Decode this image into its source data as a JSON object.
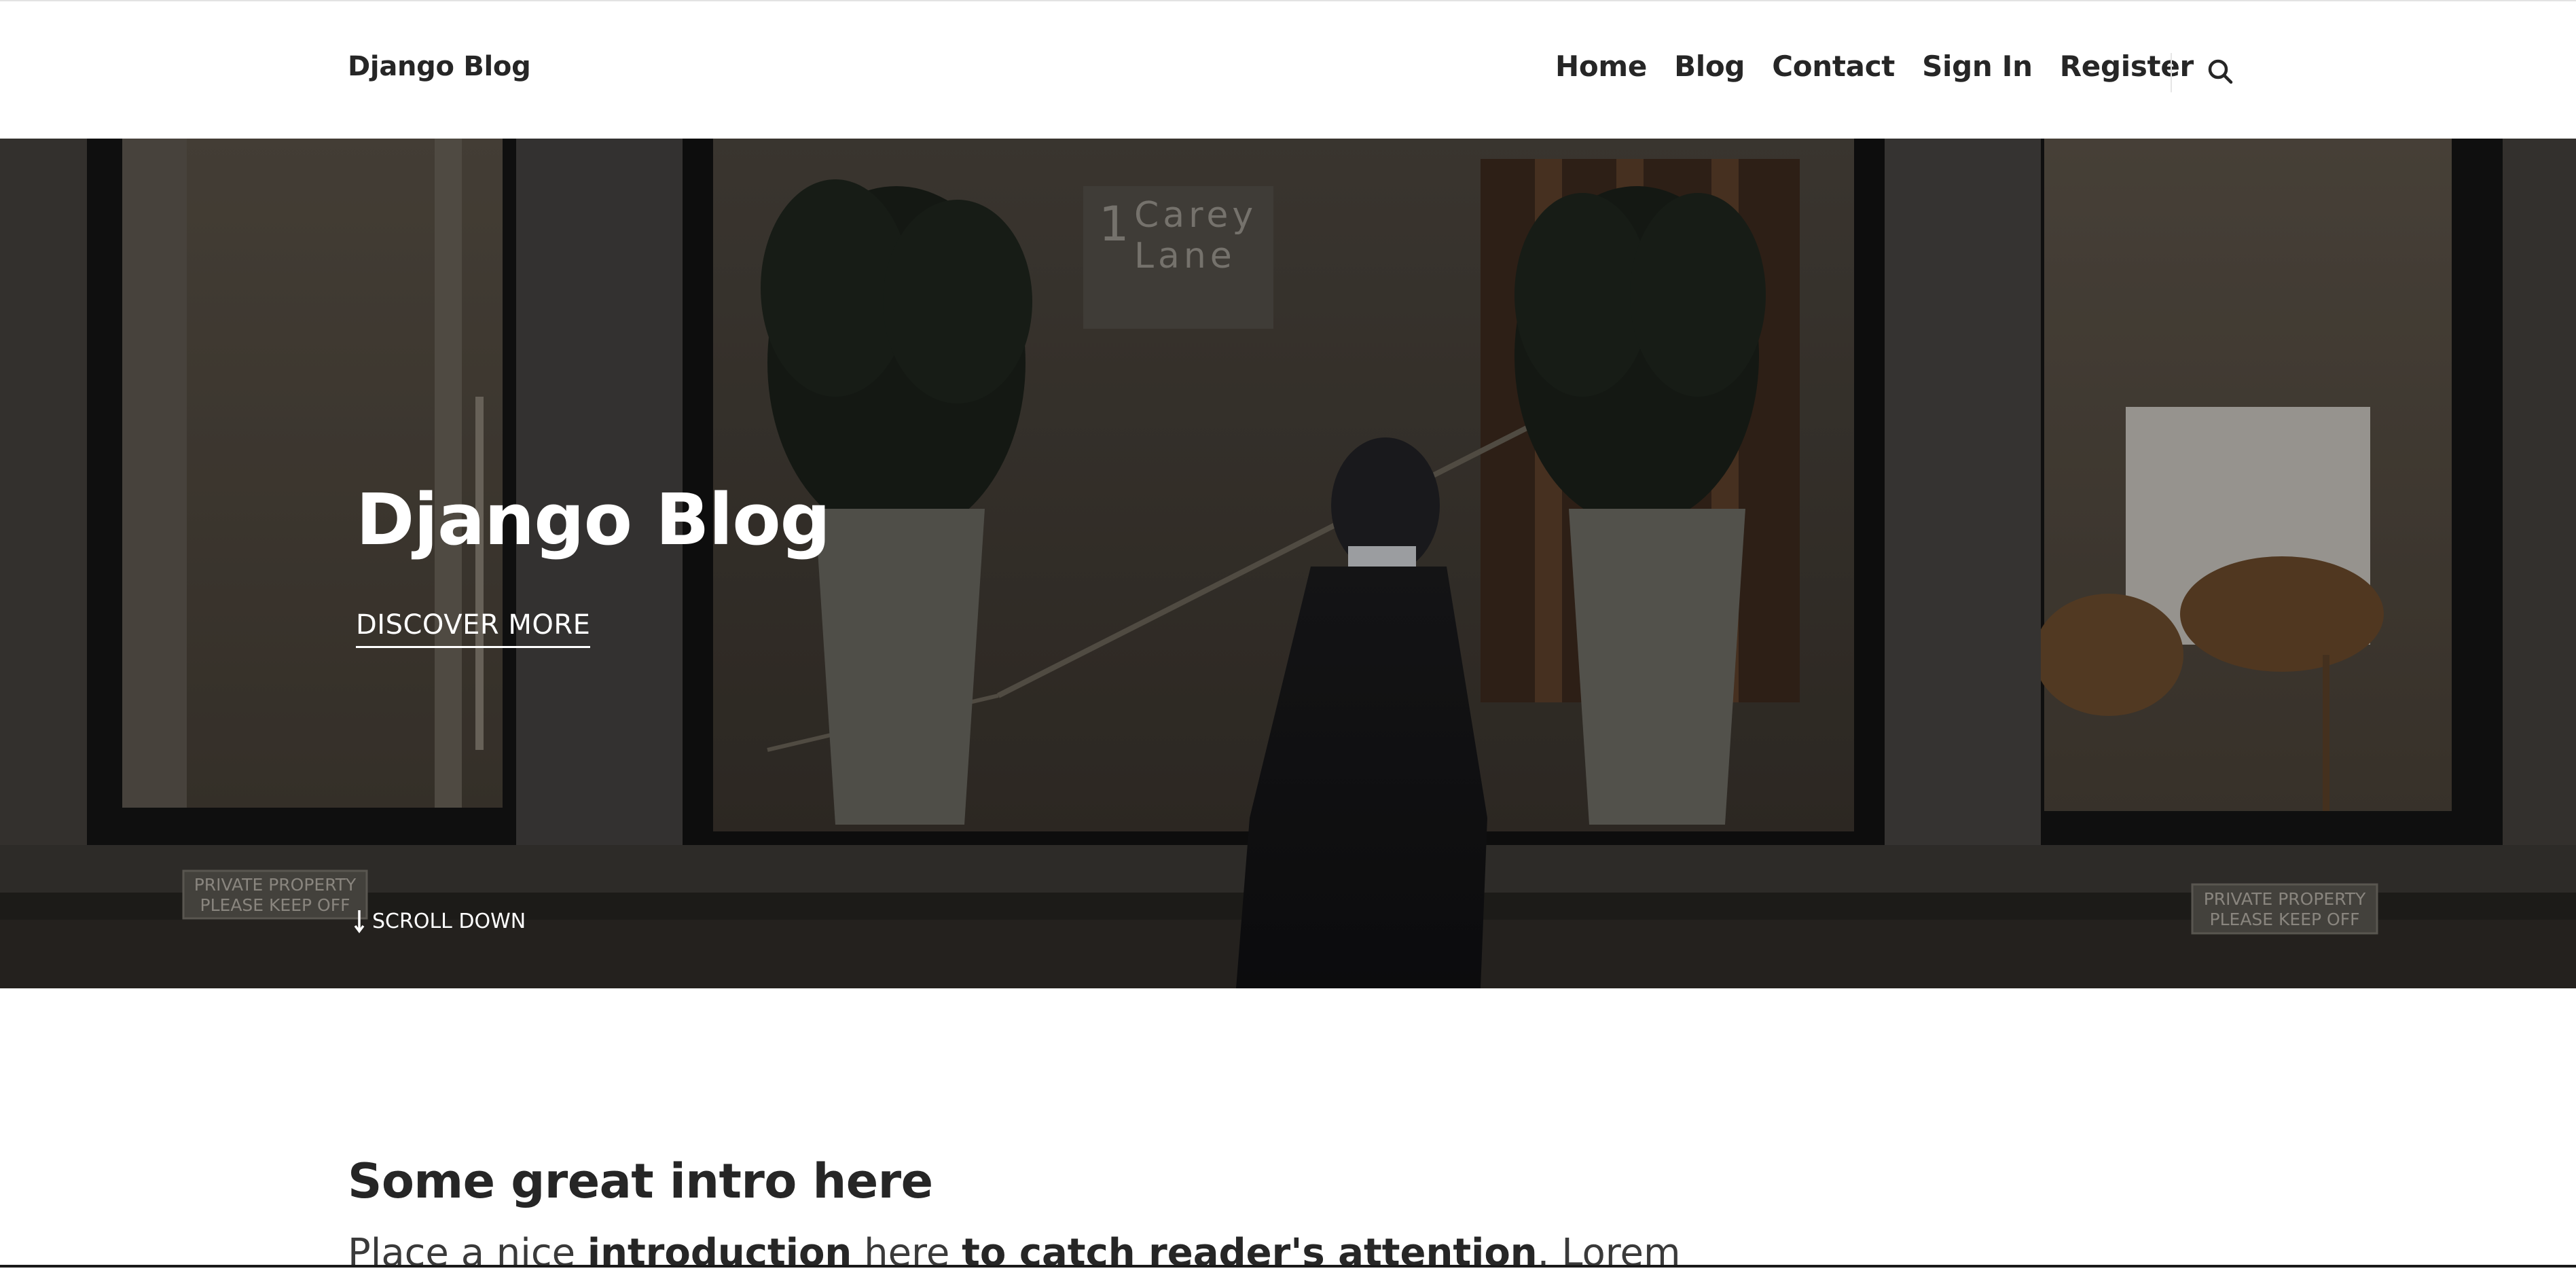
{
  "header": {
    "brand": "Django Blog",
    "nav": [
      {
        "label": "Home"
      },
      {
        "label": "Blog"
      },
      {
        "label": "Contact"
      },
      {
        "label": "Sign In"
      },
      {
        "label": "Register"
      }
    ],
    "search_icon": "search-icon"
  },
  "hero": {
    "title": "Django Blog",
    "cta": "DISCOVER MORE",
    "scroll_label": "SCROLL DOWN",
    "scroll_icon": "arrow-down-icon",
    "sign_text_line1": "Carey",
    "sign_text_line2": "Lane",
    "sign_number": "1",
    "plaque_left_line1": "PRIVATE PROPERTY",
    "plaque_left_line2": "PLEASE KEEP OFF",
    "plaque_right_line1": "PRIVATE PROPERTY",
    "plaque_right_line2": "PLEASE KEEP OFF"
  },
  "intro": {
    "title": "Some great intro here",
    "text_parts": [
      {
        "text": "Place a nice ",
        "bold": false
      },
      {
        "text": "introduction",
        "bold": true
      },
      {
        "text": " here ",
        "bold": false
      },
      {
        "text": "to catch reader's attention",
        "bold": true
      },
      {
        "text": ". Lorem",
        "bold": false
      }
    ]
  },
  "colors": {
    "text_dark": "#262626",
    "hero_overlay": "#2c2925",
    "white": "#ffffff"
  }
}
